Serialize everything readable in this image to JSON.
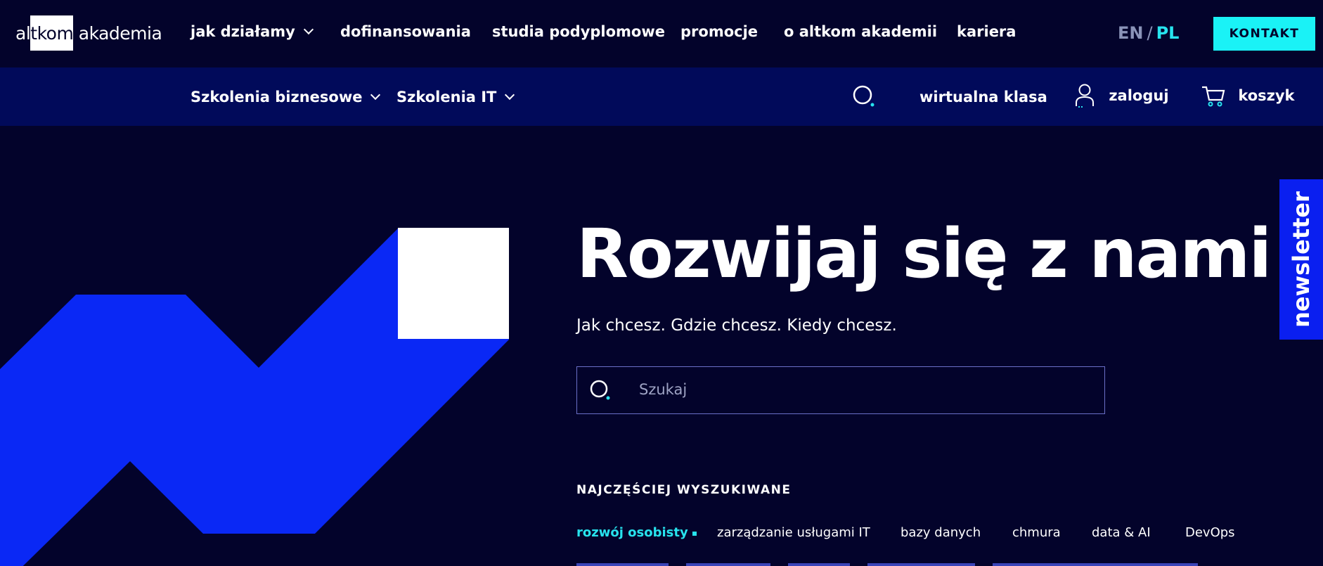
{
  "header": {
    "logo": {
      "pre": "al",
      "box": "tkom",
      "post": " akademia"
    },
    "nav": [
      {
        "label": "jak działamy",
        "dropdown": true
      },
      {
        "label": "dofinansowania"
      },
      {
        "label": "studia podyplomowe"
      },
      {
        "label": "promocje"
      },
      {
        "label": "o altkom akademii"
      },
      {
        "label": "kariera"
      }
    ],
    "lang": {
      "en": "EN",
      "sep": "/",
      "pl": "PL"
    },
    "contact_label": "KONTAKT"
  },
  "subnav": {
    "business": "Szkolenia biznesowe",
    "it": "Szkolenia IT",
    "virtual_class": "wirtualna klasa",
    "login": "zaloguj",
    "cart": "koszyk"
  },
  "newsletter": "newsletter",
  "hero": {
    "title": "Rozwijaj się z nami",
    "subtitle": "Jak chcesz. Gdzie chcesz. Kiedy chcesz.",
    "search_placeholder": "Szukaj",
    "popular_title": "NAJCZĘŚCIEJ WYSZUKIWANE",
    "tags": [
      "rozwój osobisty",
      "zarządzanie usługami IT",
      "bazy danych",
      "chmura",
      "data & AI",
      "DevOps"
    ]
  },
  "colors": {
    "bg": "#03032b",
    "subbar": "#010a5a",
    "accent": "#1af2f6",
    "blue": "#0a1ff0"
  }
}
